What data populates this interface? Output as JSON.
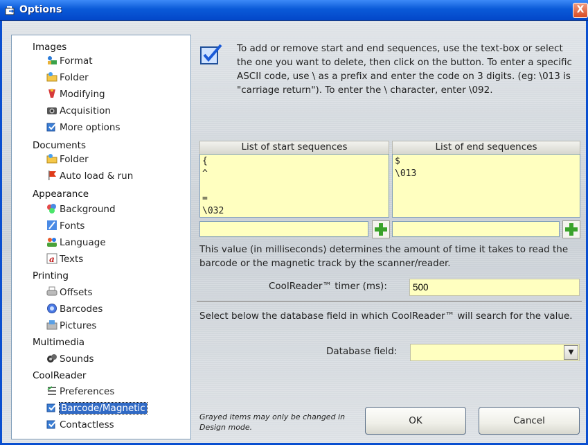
{
  "window": {
    "title": "Options",
    "close_glyph": "X"
  },
  "tree": {
    "categories": [
      {
        "label": "Images",
        "items": [
          {
            "label": "Format",
            "icon": "format-icon"
          },
          {
            "label": "Folder",
            "icon": "folder-icon"
          },
          {
            "label": "Modifying",
            "icon": "modifying-icon"
          },
          {
            "label": "Acquisition",
            "icon": "camera-icon"
          },
          {
            "label": "More options",
            "icon": "more-options-icon"
          }
        ]
      },
      {
        "label": "Documents",
        "items": [
          {
            "label": "Folder",
            "icon": "folder-icon"
          },
          {
            "label": "Auto load & run",
            "icon": "flag-icon"
          }
        ]
      },
      {
        "label": "Appearance",
        "items": [
          {
            "label": "Background",
            "icon": "background-icon"
          },
          {
            "label": "Fonts",
            "icon": "fonts-icon"
          },
          {
            "label": "Language",
            "icon": "language-icon"
          },
          {
            "label": "Texts",
            "icon": "texts-icon"
          }
        ]
      },
      {
        "label": "Printing",
        "items": [
          {
            "label": "Offsets",
            "icon": "printer-icon"
          },
          {
            "label": "Barcodes",
            "icon": "barcodes-icon"
          },
          {
            "label": "Pictures",
            "icon": "pictures-icon"
          }
        ]
      },
      {
        "label": "Multimedia",
        "items": [
          {
            "label": "Sounds",
            "icon": "sounds-icon"
          }
        ]
      },
      {
        "label": "CoolReader",
        "items": [
          {
            "label": "Preferences",
            "icon": "preferences-icon"
          },
          {
            "label": "Barcode/Magnetic",
            "icon": "barcode-magnetic-icon",
            "selected": true
          },
          {
            "label": "Contactless",
            "icon": "contactless-icon"
          }
        ]
      }
    ]
  },
  "info": {
    "text": "To add or remove start and end sequences, use the text-box or select the one you want to delete, then click on the button. To enter a specific ASCII code, use \\ as a prefix and enter the code on 3 digits. (eg: \\013 is \"carriage return\"). To enter the \\ character, enter \\092."
  },
  "start_sequences": {
    "header": "List of start sequences",
    "items": [
      "{",
      "^",
      "",
      "=",
      "\\032"
    ],
    "input_value": ""
  },
  "end_sequences": {
    "header": "List of end sequences",
    "items": [
      "$",
      "\\013"
    ],
    "input_value": ""
  },
  "timer": {
    "description": "This value (in milliseconds) determines the amount of time it takes to read the barcode or the magnetic track by the scanner/reader.",
    "label": "CoolReader™ timer (ms):",
    "value": "500"
  },
  "database": {
    "description": "Select below the database field in which CoolReader™ will search for the value.",
    "label": "Database field:",
    "value": ""
  },
  "footer": {
    "note": "Grayed items may only be changed in Design mode.",
    "ok_label": "OK",
    "cancel_label": "Cancel"
  },
  "colors": {
    "titlebar": "#0a5ad8",
    "field_background": "#ffffc0",
    "selection": "#316ac5",
    "add_button": "#3aa22a"
  }
}
